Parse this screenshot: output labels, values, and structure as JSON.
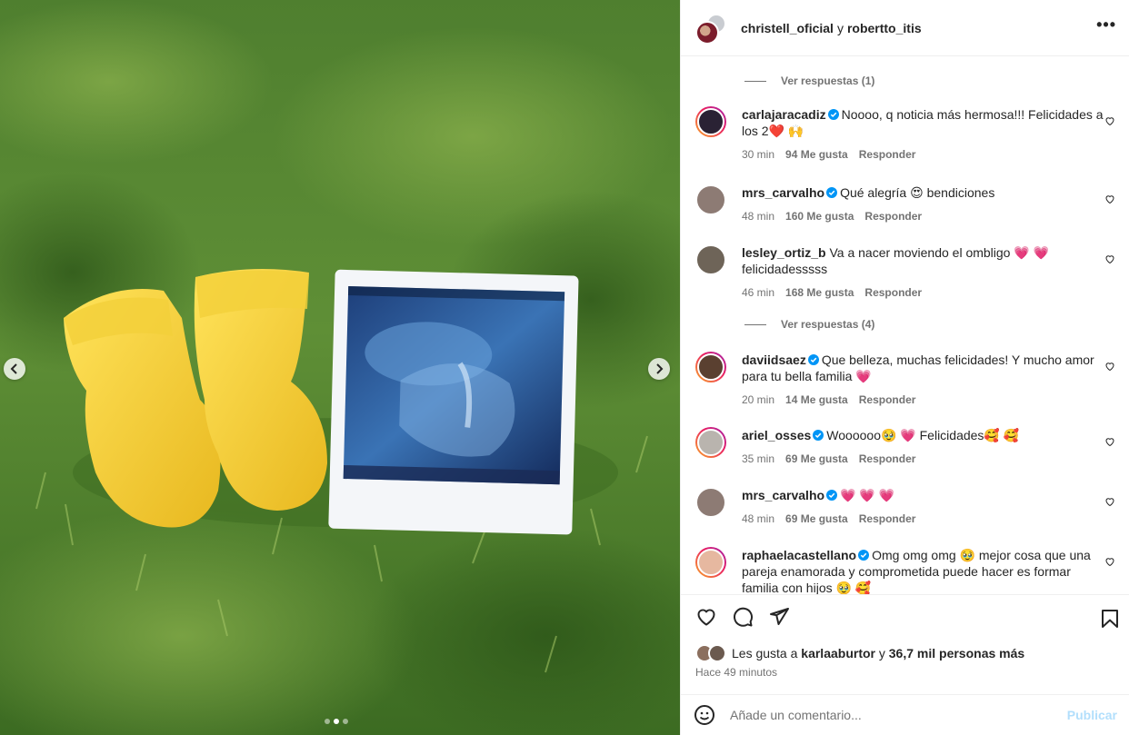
{
  "post": {
    "image_alt": "Yellow knitted baby booties next to an ultrasound photo on grass",
    "carousel_total": 3,
    "carousel_active": 2
  },
  "header": {
    "user1": "christell_oficial",
    "separator": "y",
    "user2": "robertto_itis",
    "more_icon": "more-horizontal-icon"
  },
  "comments": {
    "replies_1": "Ver respuestas (1)",
    "replies_2": "Ver respuestas (4)",
    "items": [
      {
        "user": "carlajaracadiz",
        "verified": true,
        "text": "Noooo, q noticia más hermosa!!! Felicidades a los 2❤️ 🙌",
        "time": "30 min",
        "likes": "94 Me gusta",
        "reply": "Responder",
        "avatar_color": "#2a2234"
      },
      {
        "user": "mrs_carvalho",
        "verified": true,
        "text": "Qué alegría 😍  bendiciones",
        "time": "48 min",
        "likes": "160 Me gusta",
        "reply": "Responder",
        "avatar_color": "#8d7b74"
      },
      {
        "user": "lesley_ortiz_b",
        "verified": false,
        "text": "Va a nacer moviendo el ombligo 💗 💗 felicidadesssss",
        "time": "46 min",
        "likes": "168 Me gusta",
        "reply": "Responder",
        "avatar_color": "#6e6458"
      },
      {
        "user": "daviidsaez",
        "verified": true,
        "text": "Que belleza, muchas felicidades! Y mucho amor para tu bella familia 💗",
        "time": "20 min",
        "likes": "14 Me gusta",
        "reply": "Responder",
        "avatar_color": "#5a4030"
      },
      {
        "user": "ariel_osses",
        "verified": true,
        "text": "Woooooo🥹 💗  Felicidades🥰 🥰",
        "time": "35 min",
        "likes": "69 Me gusta",
        "reply": "Responder",
        "avatar_color": "#b9b4ae"
      },
      {
        "user": "mrs_carvalho",
        "verified": true,
        "text": "💗 💗 💗",
        "time": "48 min",
        "likes": "69 Me gusta",
        "reply": "Responder",
        "avatar_color": "#8d7b74"
      },
      {
        "user": "raphaelacastellano",
        "verified": true,
        "text": "Omg omg omg 🥹  mejor cosa que una pareja enamorada y comprometida puede hacer es formar familia con hijos 🥹 🥰",
        "time": "",
        "likes": "",
        "reply": "",
        "avatar_color": "#e6b8a0"
      }
    ]
  },
  "actions": {
    "like_icon": "heart-icon",
    "comment_icon": "comment-icon",
    "share_icon": "share-icon",
    "save_icon": "bookmark-icon",
    "likes_prefix": "Les gusta a",
    "likes_user": "karlaaburtor",
    "likes_conj": "y",
    "likes_rest": "36,7 mil personas más",
    "time_ago": "Hace 49 minutos"
  },
  "add_comment": {
    "emoji_icon": "emoji-icon",
    "placeholder": "Añade un comentario...",
    "publish": "Publicar"
  },
  "colors": {
    "verified": "#0095f6",
    "heart": "#ed4956",
    "publish_disabled": "#b2dffc"
  }
}
